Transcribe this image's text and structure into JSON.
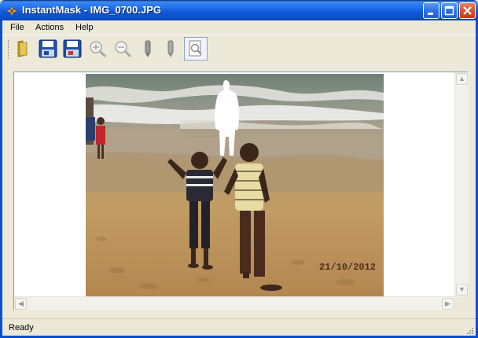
{
  "window": {
    "title": "InstantMask - IMG_0700.JPG",
    "controls": {
      "minimize": "minimize",
      "maximize": "maximize",
      "close": "close"
    }
  },
  "menu": {
    "items": [
      {
        "label": "File"
      },
      {
        "label": "Actions"
      },
      {
        "label": "Help"
      }
    ]
  },
  "toolbar": {
    "buttons": [
      {
        "icon": "open-folder-icon"
      },
      {
        "icon": "save-icon"
      },
      {
        "icon": "save-as-icon"
      },
      {
        "icon": "zoom-in-icon"
      },
      {
        "icon": "zoom-out-icon"
      },
      {
        "icon": "foreground-marker-icon"
      },
      {
        "icon": "background-marker-icon"
      },
      {
        "icon": "preview-mask-icon",
        "pressed": true
      }
    ]
  },
  "image": {
    "date_stamp": "21/10/2012"
  },
  "status": {
    "text": "Ready"
  },
  "colors": {
    "titlebar": "#0B4FCB",
    "window_bg": "#ECE9D8",
    "close_button": "#D9532E"
  }
}
